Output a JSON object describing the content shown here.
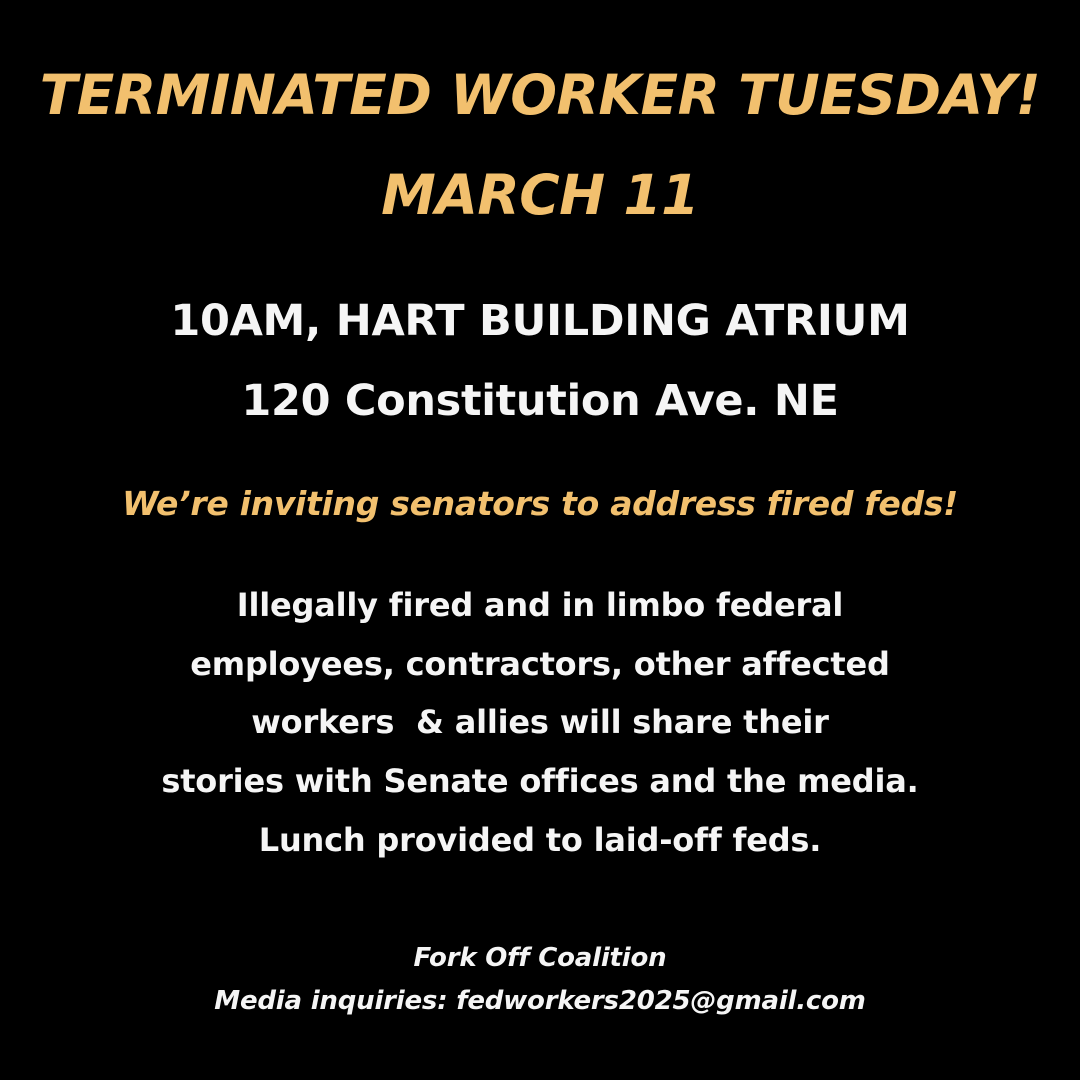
{
  "headline": {
    "line1": "TERMINATED WORKER TUESDAY!",
    "line2": "MARCH 11"
  },
  "venue": {
    "line1": "10AM, HART BUILDING ATRIUM",
    "line2": "120 Constitution Ave. NE"
  },
  "tagline": "We’re inviting senators to address fired feds!",
  "body": [
    "Illegally fired and in limbo federal",
    "employees, contractors, other affected",
    "workers  & allies will share their",
    "stories with Senate offices and the media.",
    "Lunch provided to laid-off feds."
  ],
  "footer": {
    "organization": "Fork Off Coalition",
    "contact": "Media inquiries: fedworkers2025@gmail.com"
  },
  "colors": {
    "background": "#000000",
    "accent": "#F2C06E",
    "text": "#F5F5F5"
  }
}
